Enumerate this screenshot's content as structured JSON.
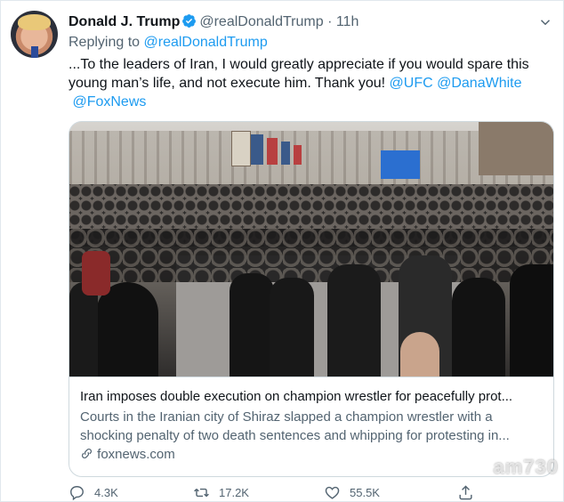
{
  "tweet": {
    "author_name": "Donald J. Trump",
    "author_handle": "@realDonaldTrump",
    "separator": "·",
    "time": "11h",
    "reply_prefix": "Replying to",
    "reply_to": "@realDonaldTrump",
    "text": "...To the leaders of Iran, I would greatly appreciate if you would spare this young man’s life, and not execute him. Thank you!",
    "mentions": [
      "@UFC",
      "@DanaWhite",
      "@FoxNews"
    ]
  },
  "card": {
    "title": "Iran imposes double execution on champion wrestler for peacefully prot...",
    "description_line1": "Courts in the Iranian city of Shiraz slapped a champion wrestler with a",
    "description_line2": "shocking penalty of two death sentences and whipping for protesting in...",
    "domain": "foxnews.com"
  },
  "actions": {
    "replies": "4.3K",
    "retweets": "17.2K",
    "likes": "55.5K"
  },
  "watermark": "am730",
  "colors": {
    "link": "#1d9bf0",
    "muted": "#536471",
    "border": "#cfd9de",
    "verified": "#1d9bf0"
  }
}
